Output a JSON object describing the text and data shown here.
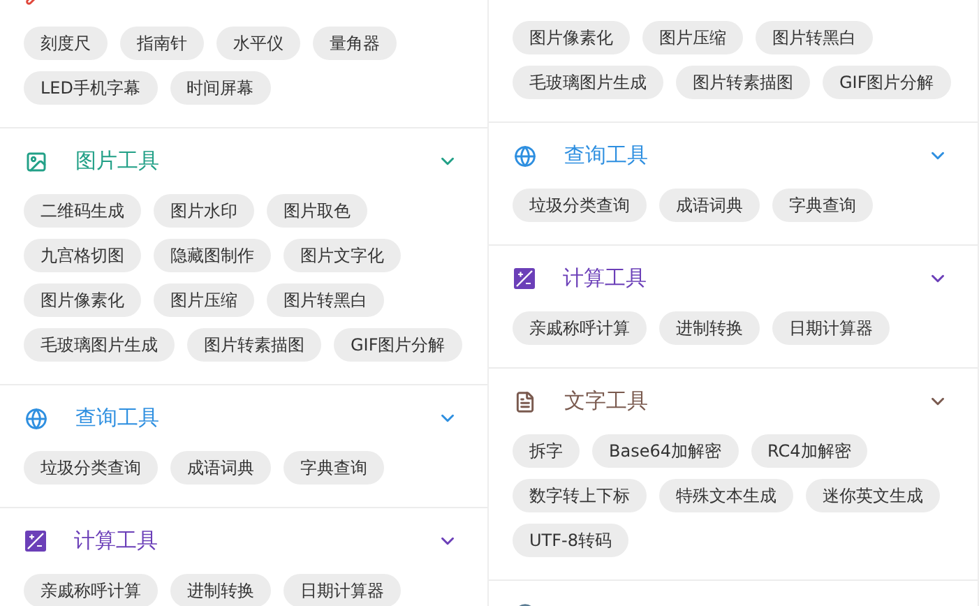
{
  "panels": [
    {
      "sections": [
        {
          "kind": "common",
          "color": "#e0463a",
          "tools": [
            "刻度尺",
            "指南针",
            "水平仪",
            "量角器",
            "LED手机字幕",
            "时间屏幕"
          ]
        },
        {
          "title": "图片工具",
          "kind": "image",
          "color": "#22a087",
          "tools": [
            "二维码生成",
            "图片水印",
            "图片取色",
            "九宫格切图",
            "隐藏图制作",
            "图片文字化",
            "图片像素化",
            "图片压缩",
            "图片转黑白",
            "毛玻璃图片生成",
            "图片转素描图",
            "GIF图片分解"
          ]
        },
        {
          "title": "查询工具",
          "kind": "query",
          "color": "#2e8fe0",
          "tools": [
            "垃圾分类查询",
            "成语词典",
            "字典查询"
          ]
        },
        {
          "title": "计算工具",
          "kind": "calc",
          "color": "#6b3fb8",
          "tools": [
            "亲戚称呼计算",
            "进制转换",
            "日期计算器"
          ]
        }
      ]
    },
    {
      "sections": [
        {
          "tools": [
            "图片像素化",
            "图片压缩",
            "图片转黑白",
            "毛玻璃图片生成",
            "图片转素描图",
            "GIF图片分解"
          ]
        },
        {
          "title": "查询工具",
          "kind": "query",
          "color": "#2e8fe0",
          "tools": [
            "垃圾分类查询",
            "成语词典",
            "字典查询"
          ]
        },
        {
          "title": "计算工具",
          "kind": "calc",
          "color": "#6b3fb8",
          "tools": [
            "亲戚称呼计算",
            "进制转换",
            "日期计算器"
          ]
        },
        {
          "title": "文字工具",
          "kind": "text",
          "color": "#7a5a4f",
          "tools": [
            "拆字",
            "Base64加解密",
            "RC4加解密",
            "数字转上下标",
            "特殊文本生成",
            "迷你英文生成",
            "UTF-8转码"
          ]
        },
        {
          "kind": "other",
          "color": "#5b7c93"
        }
      ]
    }
  ]
}
